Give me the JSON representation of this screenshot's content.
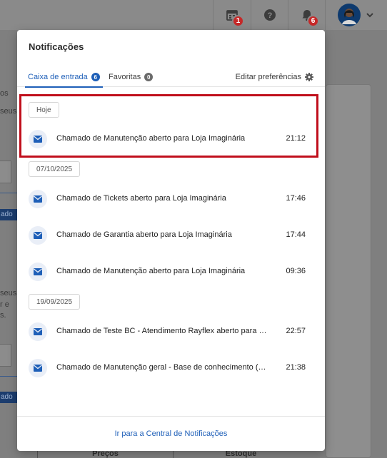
{
  "topbar": {
    "calendar_badge": "1",
    "notifications_badge": "6"
  },
  "background_fragments": {
    "left_texts": [
      "os",
      "seus",
      "seus",
      "r e",
      "s."
    ],
    "chip_labels": [
      "ado",
      "ado"
    ],
    "bottom_headers": [
      "Preços",
      "Estoque"
    ]
  },
  "panel": {
    "title": "Notificações",
    "tabs": [
      {
        "label": "Caixa de entrada",
        "count": "6"
      },
      {
        "label": "Favoritas",
        "count": "0"
      }
    ],
    "preferences_label": "Editar preferências",
    "groups": [
      {
        "date": "Hoje",
        "items": [
          {
            "text": "Chamado de Manutenção aberto para Loja Imaginária",
            "time": "21:12"
          }
        ]
      },
      {
        "date": "07/10/2025",
        "items": [
          {
            "text": "Chamado de Tickets aberto para Loja Imaginária",
            "time": "17:46"
          },
          {
            "text": "Chamado de Garantia aberto para Loja Imaginária",
            "time": "17:44"
          },
          {
            "text": "Chamado de Manutenção aberto para Loja Imaginária",
            "time": "09:36"
          }
        ]
      },
      {
        "date": "19/09/2025",
        "items": [
          {
            "text": "Chamado de Teste BC - Atendimento Rayflex aberto para 2...",
            "time": "22:57"
          },
          {
            "text": "Chamado de Manutenção geral - Base de conhecimento (E...",
            "time": "21:38"
          }
        ]
      }
    ],
    "footer_link": "Ir para a Central de Notificações"
  },
  "colors": {
    "accent": "#1e5fb8",
    "badge": "#c62828",
    "highlight": "#c00f1c",
    "overlay": "#7f7f7f"
  },
  "icons": [
    "calendar-icon",
    "help-icon",
    "bell-icon",
    "avatar",
    "chevron-down-icon",
    "gear-icon",
    "mail-icon"
  ]
}
